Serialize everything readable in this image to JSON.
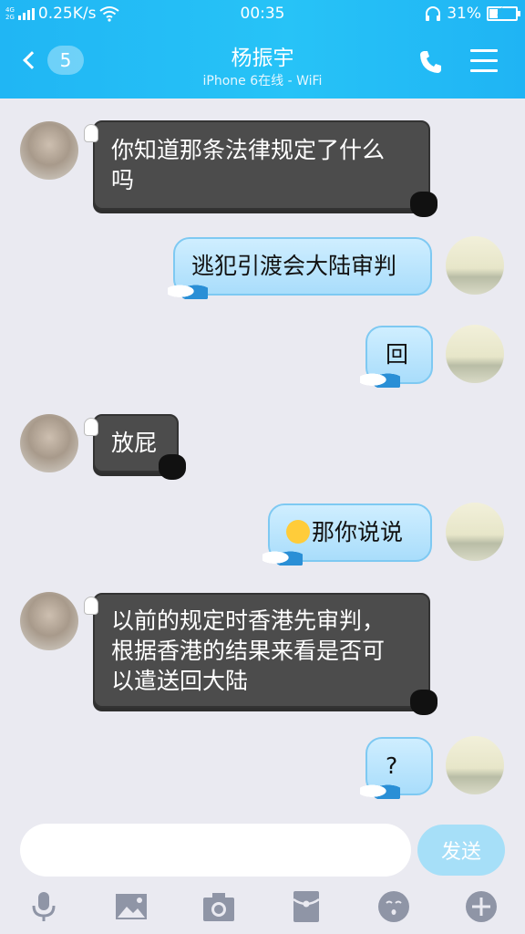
{
  "status_bar": {
    "network_top": "4G",
    "network_bottom": "2G",
    "speed": "0.25K/s",
    "time": "00:35",
    "battery": "31%",
    "battery_level": 0.31
  },
  "header": {
    "unread_count": "5",
    "contact_name": "杨振宇",
    "contact_status": "iPhone 6在线 - WiFi"
  },
  "messages": [
    {
      "from": "friend",
      "text_line1": "你知道那条法律规定了什么",
      "text_line2": "吗"
    },
    {
      "from": "me",
      "text": "逃犯引渡会大陆审判"
    },
    {
      "from": "me",
      "text": "回"
    },
    {
      "from": "friend",
      "text": "放屁"
    },
    {
      "from": "me",
      "text": "那你说说",
      "emoji": "thinking-emoji"
    },
    {
      "from": "friend",
      "text_line1": "以前的规定时香港先审判，",
      "text_line2": "根据香港的结果来看是否可",
      "text_line3": "以遣送回大陆"
    },
    {
      "from": "me",
      "text": "?"
    }
  ],
  "composer": {
    "input_value": "",
    "send_label": "发送"
  },
  "toolbar_icons": [
    "microphone-icon",
    "image-icon",
    "camera-icon",
    "red-packet-icon",
    "emoji-icon",
    "plus-icon"
  ],
  "colors": {
    "header": "#27c3f7",
    "friend_bubble": "#4c4c4c",
    "my_bubble": "#a9ddfb",
    "background": "#eaeaf1",
    "send_button": "#a6dff8"
  }
}
